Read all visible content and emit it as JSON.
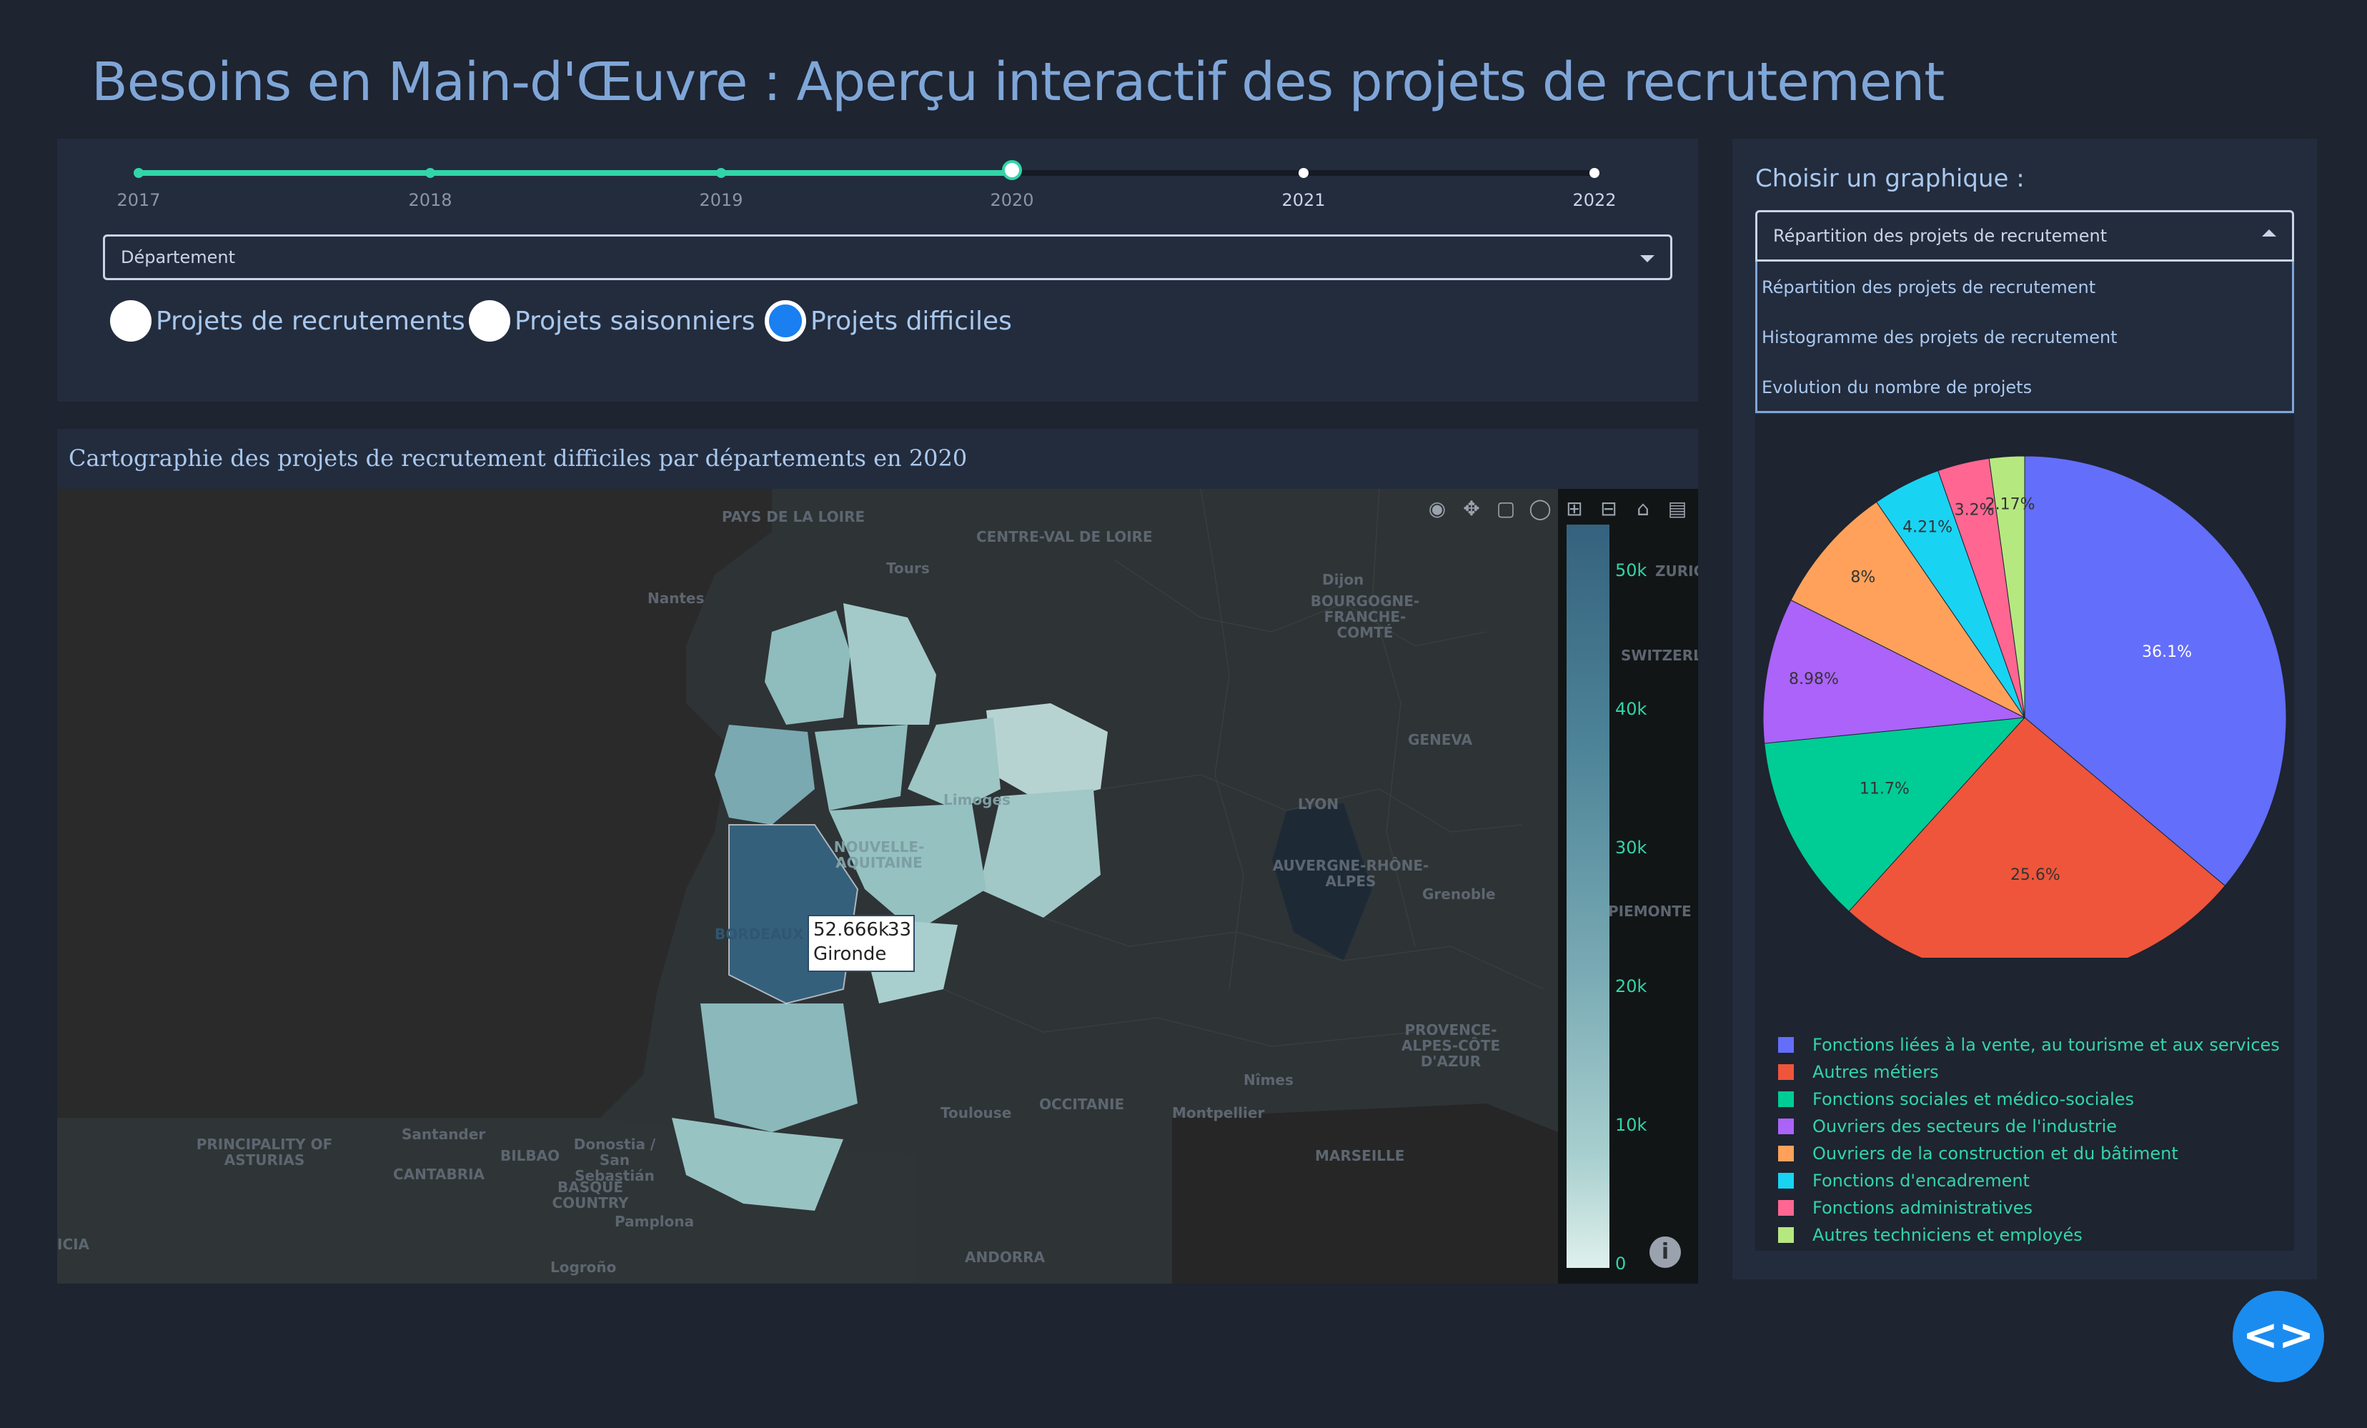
{
  "header": {
    "title": "Besoins en Main-d'Œuvre : Aperçu interactif des projets de recrutement"
  },
  "year_slider": {
    "marks": [
      "2017",
      "2018",
      "2019",
      "2020",
      "2021",
      "2022"
    ],
    "selected": "2020"
  },
  "department_select": {
    "value": "Département"
  },
  "radios": {
    "options": [
      "Projets de recrutements",
      "Projets saisonniers",
      "Projets difficiles"
    ],
    "selected": "Projets difficiles"
  },
  "graph_chooser": {
    "label": "Choisir un graphique :",
    "value": "Répartition des projets de recrutement",
    "options": [
      "Répartition des projets de recrutement",
      "Histogramme des projets de recrutement",
      "Evolution du nombre de projets"
    ]
  },
  "map": {
    "title": "Cartographie des projets de recrutement difficiles par départements en 2020",
    "colorbar_ticks": [
      "50k",
      "40k",
      "30k",
      "20k",
      "10k",
      "0"
    ],
    "tooltip": {
      "value": "52.666k",
      "name": "Gironde",
      "code": "33"
    },
    "place_labels": [
      "PAYS DE LA LOIRE",
      "CENTRE-VAL DE LOIRE",
      "Tours",
      "Nantes",
      "Dijon",
      "BOURGOGNE-FRANCHE-COMTÉ",
      "ZURICH",
      "SWITZERL",
      "GENEVA",
      "LYON",
      "AUVERGNE-RHÔNE-ALPES",
      "Grenoble",
      "PIEMONTE",
      "PROVENCE-ALPES-CÔTE D'AZUR",
      "OCCITANIE",
      "Toulouse",
      "Montpellier",
      "Nîmes",
      "MARSEILLE",
      "PRINCIPALITY OF ASTURIAS",
      "CANTABRIA",
      "BASQUE COUNTRY",
      "Santander",
      "BILBAO",
      "Donostia / San Sebastián",
      "Pamplona",
      "ANDORRA",
      "Logroño",
      "NOUVELLE-AQUITAINE",
      "Limoges",
      "BORDEAUX",
      "ICIA"
    ],
    "colors": {
      "dark": "#35627e",
      "light": "#dff0ec",
      "gironde": "#305a78"
    }
  },
  "chart_data": {
    "type": "pie",
    "labels": [
      "Fonctions liées à la vente, au tourisme et aux services",
      "Autres métiers",
      "Fonctions sociales et médico-sociales",
      "Ouvriers des secteurs de l'industrie",
      "Ouvriers de la construction et du bâtiment",
      "Fonctions d'encadrement",
      "Fonctions administratives",
      "Autres techniciens et employés"
    ],
    "values": [
      36.1,
      25.6,
      11.7,
      8.98,
      8,
      4.21,
      3.2,
      2.17
    ],
    "text_labels": [
      "36.1%",
      "25.6%",
      "11.7%",
      "8.98%",
      "8%",
      "4.21%",
      "3.2%",
      "2.17%"
    ],
    "colors": [
      "#636efa",
      "#ef553b",
      "#00cc96",
      "#ab63fa",
      "#ffa15a",
      "#19d3f3",
      "#ff6692",
      "#b6e880"
    ],
    "legend_position": "bottom"
  }
}
